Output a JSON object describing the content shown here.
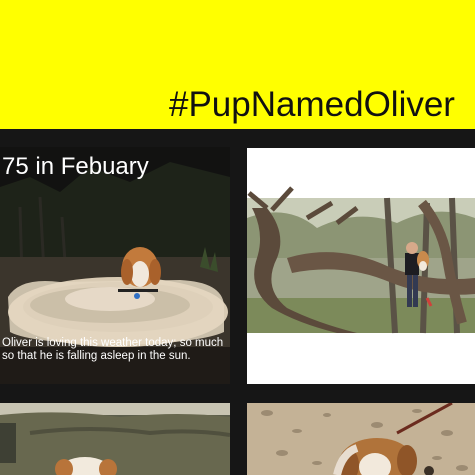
{
  "header": {
    "hashtag": "#PupNamedOliver",
    "background_color": "#ffff00"
  },
  "posts": [
    {
      "title": "75 in Febuary",
      "caption": "Oliver is loving this weather today; so much so that he is falling asleep in the sun.",
      "image": "dog-sleeping-on-pet-bed-photo"
    },
    {
      "image": "person-holding-dog-by-twisted-oak-tree-photo"
    },
    {
      "image": "dog-on-green-couch-photo"
    },
    {
      "image": "dog-on-sand-with-leash-photo"
    }
  ]
}
